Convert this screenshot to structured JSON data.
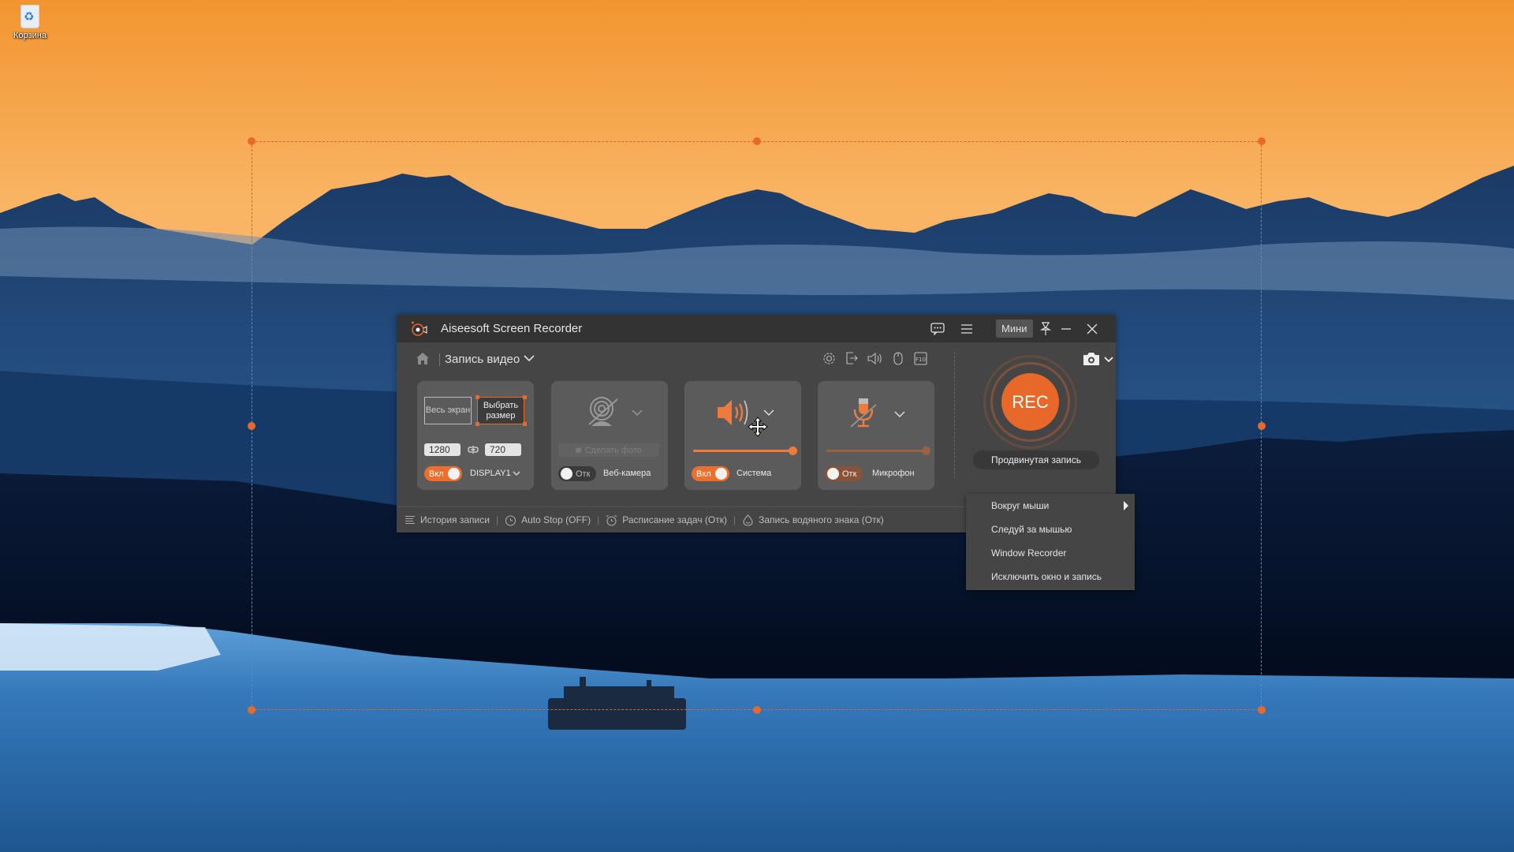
{
  "desktop": {
    "recycle_bin_label": "Корзина"
  },
  "window": {
    "title": "Aiseesoft Screen Recorder",
    "mini_label": "Мини",
    "mode_label": "Запись видео"
  },
  "cards": {
    "display": {
      "full_screen_label": "Весь экран",
      "custom_size_label": "Выбрать размер",
      "width_value": "1280",
      "height_value": "720",
      "toggle_label": "Вкл",
      "toggle_on": true,
      "display_select": "DISPLAY1"
    },
    "webcam": {
      "snapshot_label": "Сделать фото",
      "toggle_label": "Отк",
      "toggle_on": false,
      "label": "Веб-камера"
    },
    "system_sound": {
      "toggle_label": "Вкл",
      "toggle_on": true,
      "label": "Система",
      "volume_percent": 100
    },
    "microphone": {
      "toggle_label": "Отк",
      "toggle_on": false,
      "label": "Микрофон",
      "volume_percent": 100
    }
  },
  "rec": {
    "label": "REC",
    "advanced_label": "Продвинутая запись"
  },
  "footer": {
    "history_label": "История записи",
    "auto_stop_label": "Auto Stop (OFF)",
    "schedule_label": "Расписание задач (Отк)",
    "watermark_label": "Запись водяного знака (Отк)"
  },
  "context_menu": {
    "items": [
      {
        "label": "Вокруг мыши",
        "has_submenu": true
      },
      {
        "label": "Следуй за мышью",
        "has_submenu": false
      },
      {
        "label": "Window Recorder",
        "has_submenu": false
      },
      {
        "label": "Исключить окно и запись",
        "has_submenu": false
      }
    ]
  },
  "colors": {
    "accent": "#e8682a",
    "window_bg": "#454545",
    "titlebar_bg": "#333333",
    "card_bg": "#5b5b5b"
  }
}
